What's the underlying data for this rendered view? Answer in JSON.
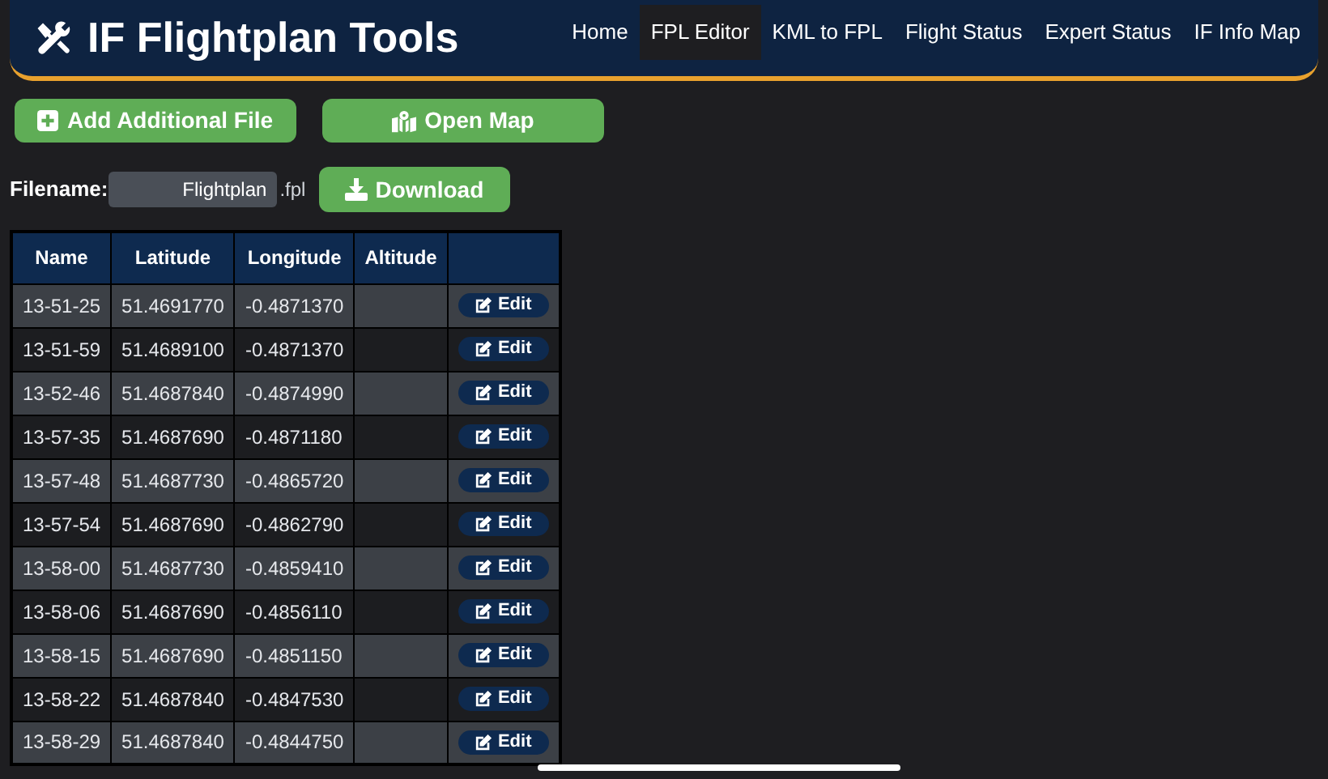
{
  "header": {
    "title": "IF Flightplan Tools",
    "nav": [
      {
        "label": "Home",
        "selected": false
      },
      {
        "label": "FPL Editor",
        "selected": true
      },
      {
        "label": "KML to FPL",
        "selected": false
      },
      {
        "label": "Flight Status",
        "selected": false
      },
      {
        "label": "Expert Status",
        "selected": false
      },
      {
        "label": "IF Info Map",
        "selected": false
      }
    ]
  },
  "actions": {
    "add_file": "Add Additional File",
    "open_map": "Open Map"
  },
  "filename": {
    "label": "Filename:",
    "value": "Flightplan",
    "suffix": ".fpl",
    "download": "Download"
  },
  "table": {
    "columns": [
      "Name",
      "Latitude",
      "Longitude",
      "Altitude"
    ],
    "rows": [
      {
        "name": "13-51-25",
        "latitude": "51.4691770",
        "longitude": "-0.4871370",
        "action": "Edit"
      },
      {
        "name": "13-51-59",
        "latitude": "51.4689100",
        "longitude": "-0.4871370",
        "action": "Edit"
      },
      {
        "name": "13-52-46",
        "latitude": "51.4687840",
        "longitude": "-0.4874990",
        "action": "Edit"
      },
      {
        "name": "13-57-35",
        "latitude": "51.4687690",
        "longitude": "-0.4871180",
        "action": "Edit"
      },
      {
        "name": "13-57-48",
        "latitude": "51.4687730",
        "longitude": "-0.4865720",
        "action": "Edit"
      },
      {
        "name": "13-57-54",
        "latitude": "51.4687690",
        "longitude": "-0.4862790",
        "action": "Edit"
      },
      {
        "name": "13-58-00",
        "latitude": "51.4687730",
        "longitude": "-0.4859410",
        "action": "Edit"
      },
      {
        "name": "13-58-06",
        "latitude": "51.4687690",
        "longitude": "-0.4856110",
        "action": "Edit"
      },
      {
        "name": "13-58-15",
        "latitude": "51.4687690",
        "longitude": "-0.4851150",
        "action": "Edit"
      },
      {
        "name": "13-58-22",
        "latitude": "51.4687840",
        "longitude": "-0.4847530",
        "action": "Edit"
      },
      {
        "name": "13-58-29",
        "latitude": "51.4687840",
        "longitude": "-0.4844750",
        "action": "Edit"
      }
    ]
  }
}
